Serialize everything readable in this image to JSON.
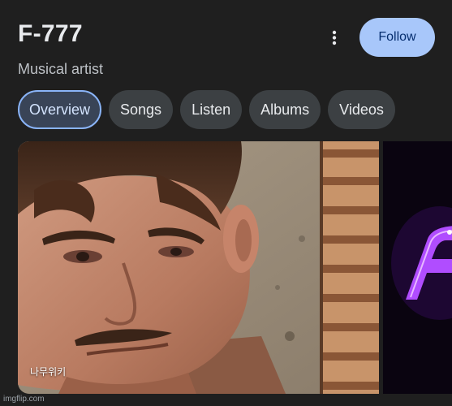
{
  "artist": {
    "name": "F-777",
    "type": "Musical artist"
  },
  "header": {
    "follow_label": "Follow",
    "more_icon": "more-vert-icon"
  },
  "tabs": [
    {
      "label": "Overview",
      "active": true
    },
    {
      "label": "Songs",
      "active": false
    },
    {
      "label": "Listen",
      "active": false
    },
    {
      "label": "Albums",
      "active": false
    },
    {
      "label": "Videos",
      "active": false
    }
  ],
  "images": {
    "main_source": "나무위키"
  },
  "watermark": "imgflip.com",
  "colors": {
    "background": "#1f1f1f",
    "follow_button": "#a8c7fa",
    "tab_background": "#3c4043",
    "active_tab_border": "#8ab4f8",
    "accent_purple": "#9b3dff"
  }
}
